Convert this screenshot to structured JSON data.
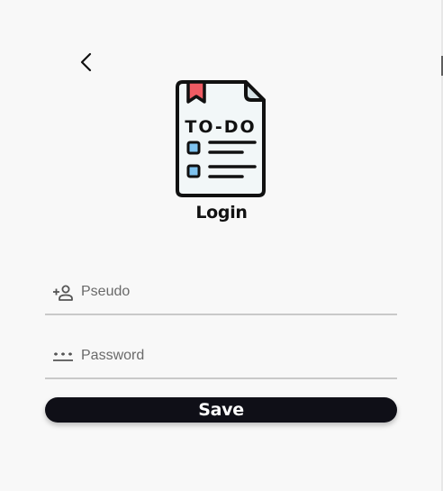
{
  "header": {
    "back_icon": "chevron-left-icon",
    "logo_icon": "todo-document-icon",
    "logo_text": "TO-DO",
    "title": "Login"
  },
  "form": {
    "pseudo": {
      "icon": "person-add-icon",
      "placeholder": "Pseudo",
      "value": ""
    },
    "password": {
      "icon": "password-dots-icon",
      "placeholder": "Password",
      "value": ""
    },
    "save_label": "Save"
  },
  "colors": {
    "background": "#f8f8f8",
    "button": "#0f0f17",
    "button_text": "#ffffff",
    "underline": "#c9c9c9",
    "bookmark": "#ef5b63",
    "checkbox": "#7fc3ef",
    "paper": "#f2f7f8"
  }
}
